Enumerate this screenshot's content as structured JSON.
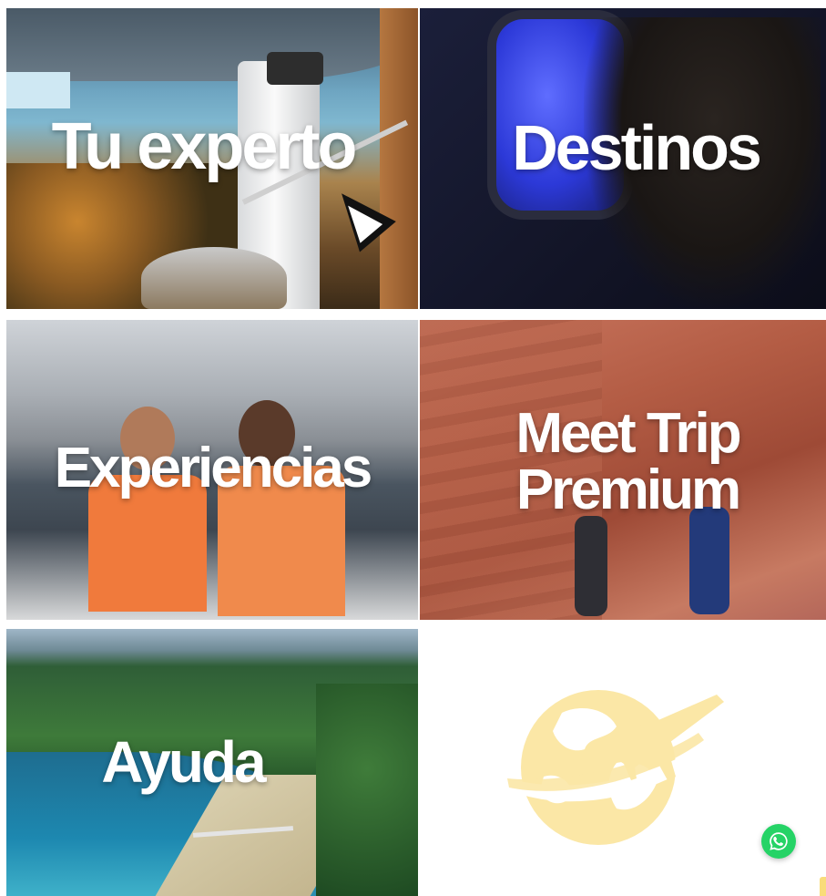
{
  "tiles": [
    {
      "id": "tu-experto",
      "label": "Tu experto"
    },
    {
      "id": "destinos",
      "label": "Destinos"
    },
    {
      "id": "experiencias",
      "label": "Experiencias"
    },
    {
      "id": "meet-trip-premium",
      "label_line1": "Meet Trip",
      "label_line2": "Premium"
    },
    {
      "id": "ayuda",
      "label": "Ayuda"
    }
  ],
  "logo": {
    "icon": "globe-airplane-icon",
    "color": "#fbe7a6"
  },
  "whatsapp": {
    "icon": "whatsapp-icon",
    "color": "#25d366"
  },
  "colors": {
    "label_text": "#ffffff",
    "background": "#ffffff"
  }
}
